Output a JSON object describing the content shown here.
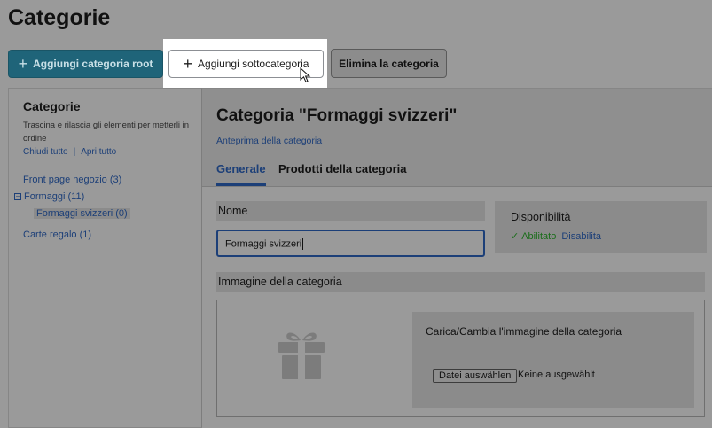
{
  "page": {
    "title": "Categorie"
  },
  "toolbar": {
    "add_root_label": "Aggiungi categoria root",
    "add_sub_label": "Aggiungi sottocategoria",
    "delete_label": "Elimina la categoria"
  },
  "sidebar": {
    "title": "Categorie",
    "hint": "Trascina e rilascia gli elementi per metterli in ordine",
    "collapse_all": "Chiudi tutto",
    "separator": "|",
    "expand_all": "Apri tutto",
    "tree": [
      {
        "label": "Front page negozio (3)"
      },
      {
        "toggle": "−",
        "label": "Formaggi (11)"
      },
      {
        "label": "Formaggi svizzeri (0)",
        "selected": true
      },
      {
        "label": "Carte regalo (1)"
      }
    ]
  },
  "category": {
    "title": "Categoria \"Formaggi svizzeri\"",
    "preview_link": "Anteprima della categoria",
    "tabs": [
      {
        "label": "Generale",
        "active": true
      },
      {
        "label": "Prodotti della categoria",
        "active": false
      }
    ],
    "name_label": "Nome",
    "name_value": "Formaggi svizzeri",
    "availability": {
      "title": "Disponibilità",
      "check": "✓",
      "enabled": "Abilitato",
      "disable": "Disabilita"
    },
    "image": {
      "label": "Immagine della categoria",
      "upload_text": "Carica/Cambia l'immagine della categoria",
      "file_button": "Datei auswählen",
      "file_none": "Keine ausgewählt"
    }
  },
  "colors": {
    "accent": "#1c3f78",
    "primary_button": "#1f6479",
    "success": "#1a6d1a",
    "dim_background": "#9a9a9a"
  }
}
